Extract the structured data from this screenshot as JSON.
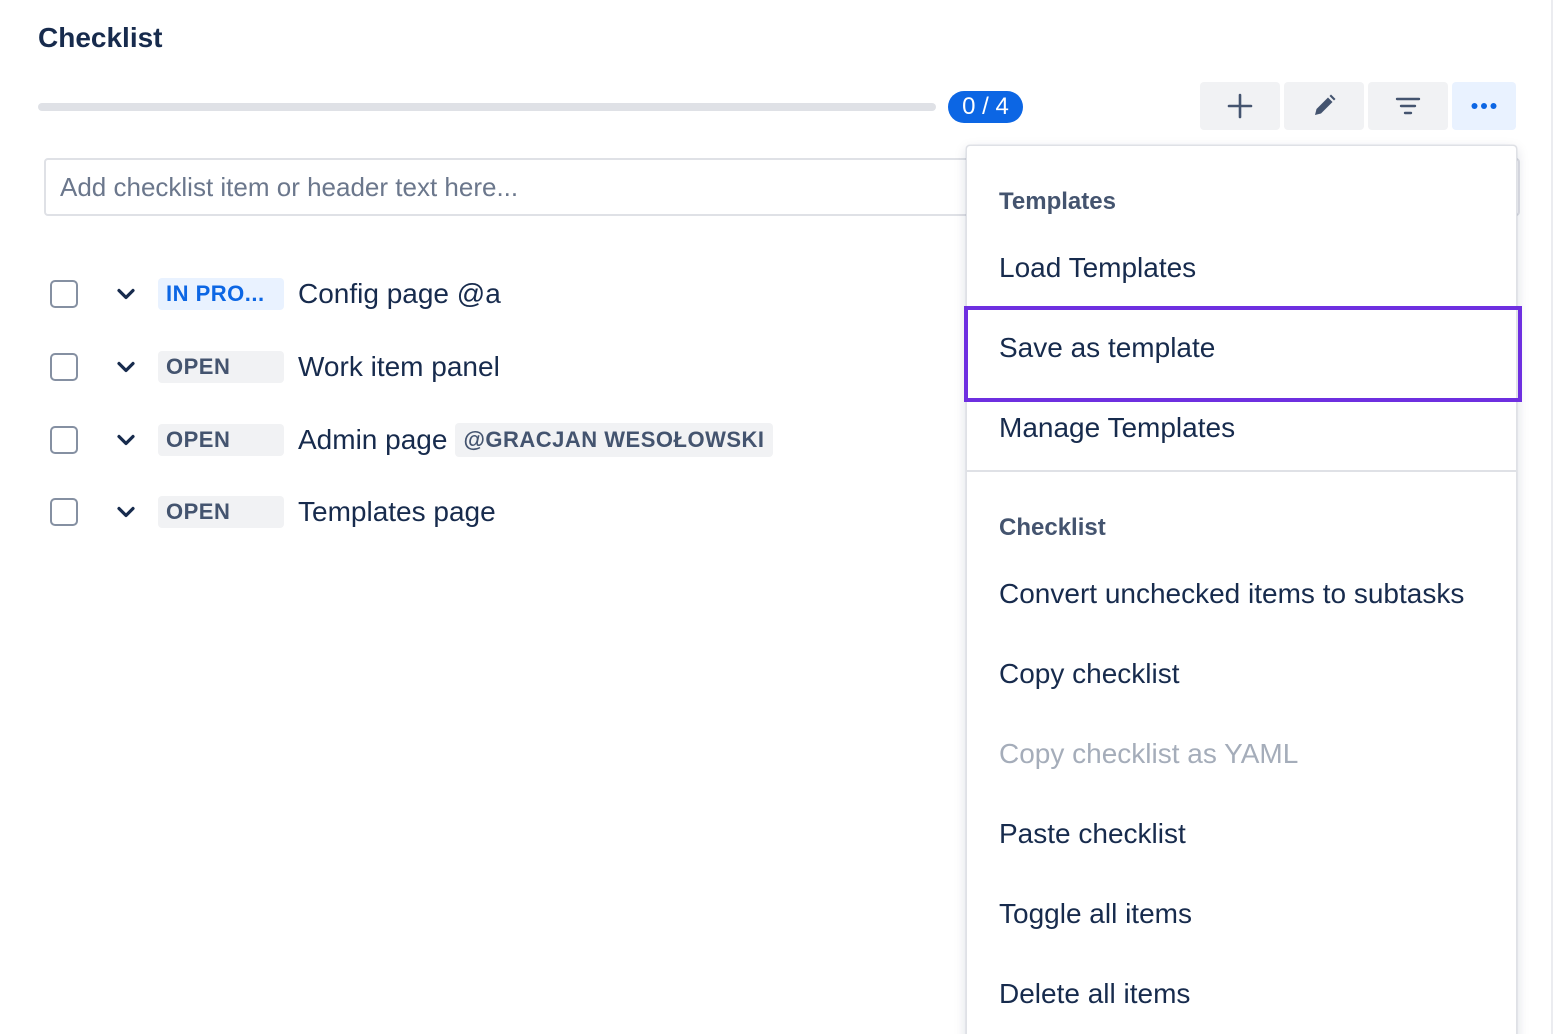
{
  "header": {
    "title": "Checklist",
    "progress_label": "0 / 4",
    "progress_fraction": 0
  },
  "toolbar": {
    "buttons": [
      {
        "name": "add",
        "icon": "plus-icon"
      },
      {
        "name": "edit",
        "icon": "pencil-icon"
      },
      {
        "name": "filter",
        "icon": "filter-icon"
      },
      {
        "name": "more",
        "icon": "more-horizontal-icon",
        "active": true
      }
    ]
  },
  "add_item": {
    "placeholder": "Add checklist item or header text here..."
  },
  "items": [
    {
      "status": "IN PRO...",
      "status_type": "inprogress",
      "text": "Config page @a",
      "checked": false
    },
    {
      "status": "OPEN",
      "status_type": "open",
      "text": "Work item panel",
      "checked": false
    },
    {
      "status": "OPEN",
      "status_type": "open",
      "text": "Admin page",
      "mention": "@GRACJAN WESOŁOWSKI",
      "checked": false
    },
    {
      "status": "OPEN",
      "status_type": "open",
      "text": "Templates page",
      "checked": false
    }
  ],
  "menu": {
    "templates_title": "Templates",
    "load_templates": "Load Templates",
    "save_as_template": "Save as template",
    "manage_templates": "Manage Templates",
    "checklist_title": "Checklist",
    "convert_unchecked": "Convert unchecked items to subtasks",
    "copy_checklist": "Copy checklist",
    "copy_checklist_yaml": "Copy checklist as YAML",
    "paste_checklist": "Paste checklist",
    "toggle_all": "Toggle all items",
    "delete_all": "Delete all items"
  },
  "colors": {
    "accent": "#0c66e4",
    "highlight": "#6e2fe0",
    "text": "#172b4d",
    "disabled_text": "#a5adba"
  }
}
